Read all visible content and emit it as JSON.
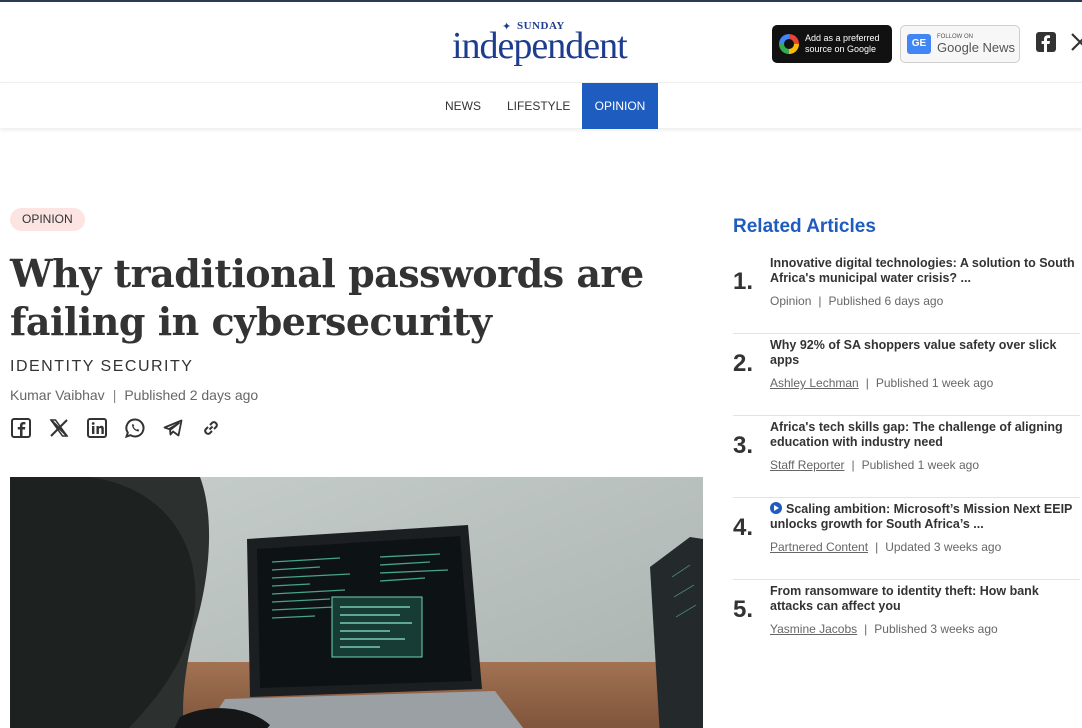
{
  "brand": {
    "top_word": "SUNDAY",
    "name": "independent"
  },
  "header_badges": {
    "google_preferred": "Add as a preferred source on Google",
    "google_news_follow": "FOLLOW ON",
    "google_news_name": "Google News",
    "google_news_icon_text": "GE"
  },
  "social_header": [
    "facebook-icon",
    "x-icon"
  ],
  "nav": {
    "items": [
      {
        "label": "NEWS",
        "active": false
      },
      {
        "label": "LIFESTYLE",
        "active": false
      },
      {
        "label": "OPINION",
        "active": true
      }
    ],
    "active_color": "#1f5cc0"
  },
  "article": {
    "section": "OPINION",
    "headline": "Why traditional passwords are failing in cybersecurity",
    "subsection": "IDENTITY SECURITY",
    "author": "Kumar Vaibhav",
    "separator": "|",
    "published": "Published 2 days ago",
    "share_icons": [
      "facebook-icon",
      "x-icon",
      "linkedin-icon",
      "whatsapp-icon",
      "telegram-icon",
      "link-icon"
    ]
  },
  "sidebar": {
    "title": "Related Articles",
    "accent_color": "#1f5cc0",
    "items": [
      {
        "num": "1.",
        "title": "Innovative digital technologies: A solution to South Africa's municipal water crisis? ...",
        "author": "Opinion",
        "author_link": false,
        "published": "Published 6 days ago",
        "video": false
      },
      {
        "num": "2.",
        "title": "Why 92% of SA shoppers value safety over slick apps",
        "author": "Ashley Lechman",
        "author_link": true,
        "published": "Published 1 week ago",
        "video": false
      },
      {
        "num": "3.",
        "title": "Africa's tech skills gap: The challenge of aligning education with industry need",
        "author": "Staff Reporter",
        "author_link": true,
        "published": "Published 1 week ago",
        "video": false
      },
      {
        "num": "4.",
        "title": "Scaling ambition: Microsoft’s Mission Next EEIP unlocks growth for South Africa’s ...",
        "author": "Partnered Content",
        "author_link": true,
        "published": "Updated 3 weeks ago",
        "video": true
      },
      {
        "num": "5.",
        "title": "From ransomware to identity theft: How bank attacks can affect you",
        "author": "Yasmine Jacobs",
        "author_link": true,
        "published": "Published 3 weeks ago",
        "video": false
      }
    ]
  }
}
